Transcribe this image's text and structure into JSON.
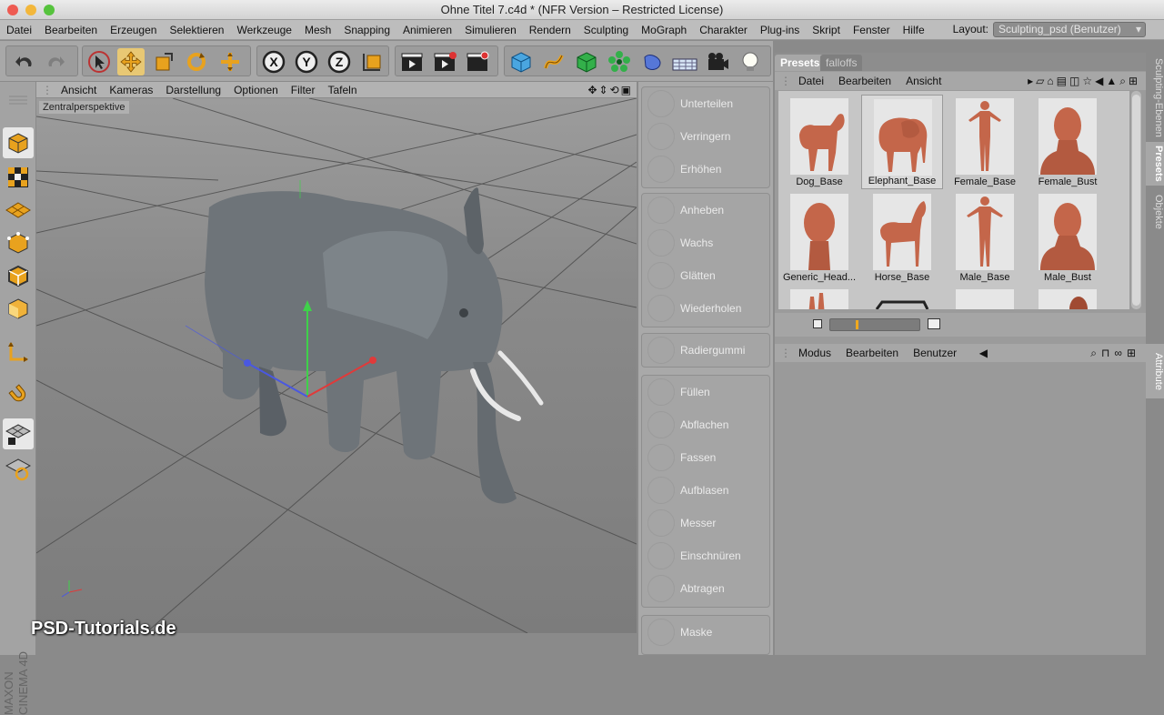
{
  "window": {
    "title": "Ohne Titel 7.c4d * (NFR Version – Restricted License)"
  },
  "menubar": {
    "items": [
      "Datei",
      "Bearbeiten",
      "Erzeugen",
      "Selektieren",
      "Werkzeuge",
      "Mesh",
      "Snapping",
      "Animieren",
      "Simulieren",
      "Rendern",
      "Sculpting",
      "MoGraph",
      "Charakter",
      "Plug-ins",
      "Skript",
      "Fenster",
      "Hilfe"
    ],
    "layout_label": "Layout:",
    "layout_value": "Sculpting_psd (Benutzer)"
  },
  "viewport": {
    "menu": [
      "Ansicht",
      "Kameras",
      "Darstellung",
      "Optionen",
      "Filter",
      "Tafeln"
    ],
    "camera_label": "Zentralperspektive"
  },
  "brushes": {
    "groups": [
      [
        "Unterteilen",
        "Verringern",
        "Erhöhen"
      ],
      [
        "Anheben",
        "Wachs",
        "Glätten",
        "Wiederholen"
      ],
      [
        "Radiergummi"
      ],
      [
        "Füllen",
        "Abflachen",
        "Fassen",
        "Aufblasen",
        "Messer",
        "Einschnüren",
        "Abtragen"
      ],
      [
        "Maske"
      ]
    ]
  },
  "presets": {
    "tabs": [
      "Presets",
      "falloffs"
    ],
    "menu": [
      "Datei",
      "Bearbeiten",
      "Ansicht"
    ],
    "items": [
      {
        "label": "Dog_Base"
      },
      {
        "label": "Elephant_Base",
        "selected": true
      },
      {
        "label": "Female_Base"
      },
      {
        "label": "Female_Bust"
      },
      {
        "label": "Generic_Head..."
      },
      {
        "label": "Horse_Base"
      },
      {
        "label": "Male_Base"
      },
      {
        "label": "Male_Bust"
      }
    ]
  },
  "attributes": {
    "menu": [
      "Modus",
      "Bearbeiten",
      "Benutzer"
    ]
  },
  "sidetabs": [
    "Sculpting-Ebenen",
    "Presets",
    "Objekte",
    "Attribute"
  ],
  "watermark": "PSD-Tutorials.de",
  "branding": "MAXON CINEMA 4D",
  "colors": {
    "accent": "#e8c874",
    "model_clay": "#c4664a",
    "elephant_grey": "#6e7479"
  }
}
